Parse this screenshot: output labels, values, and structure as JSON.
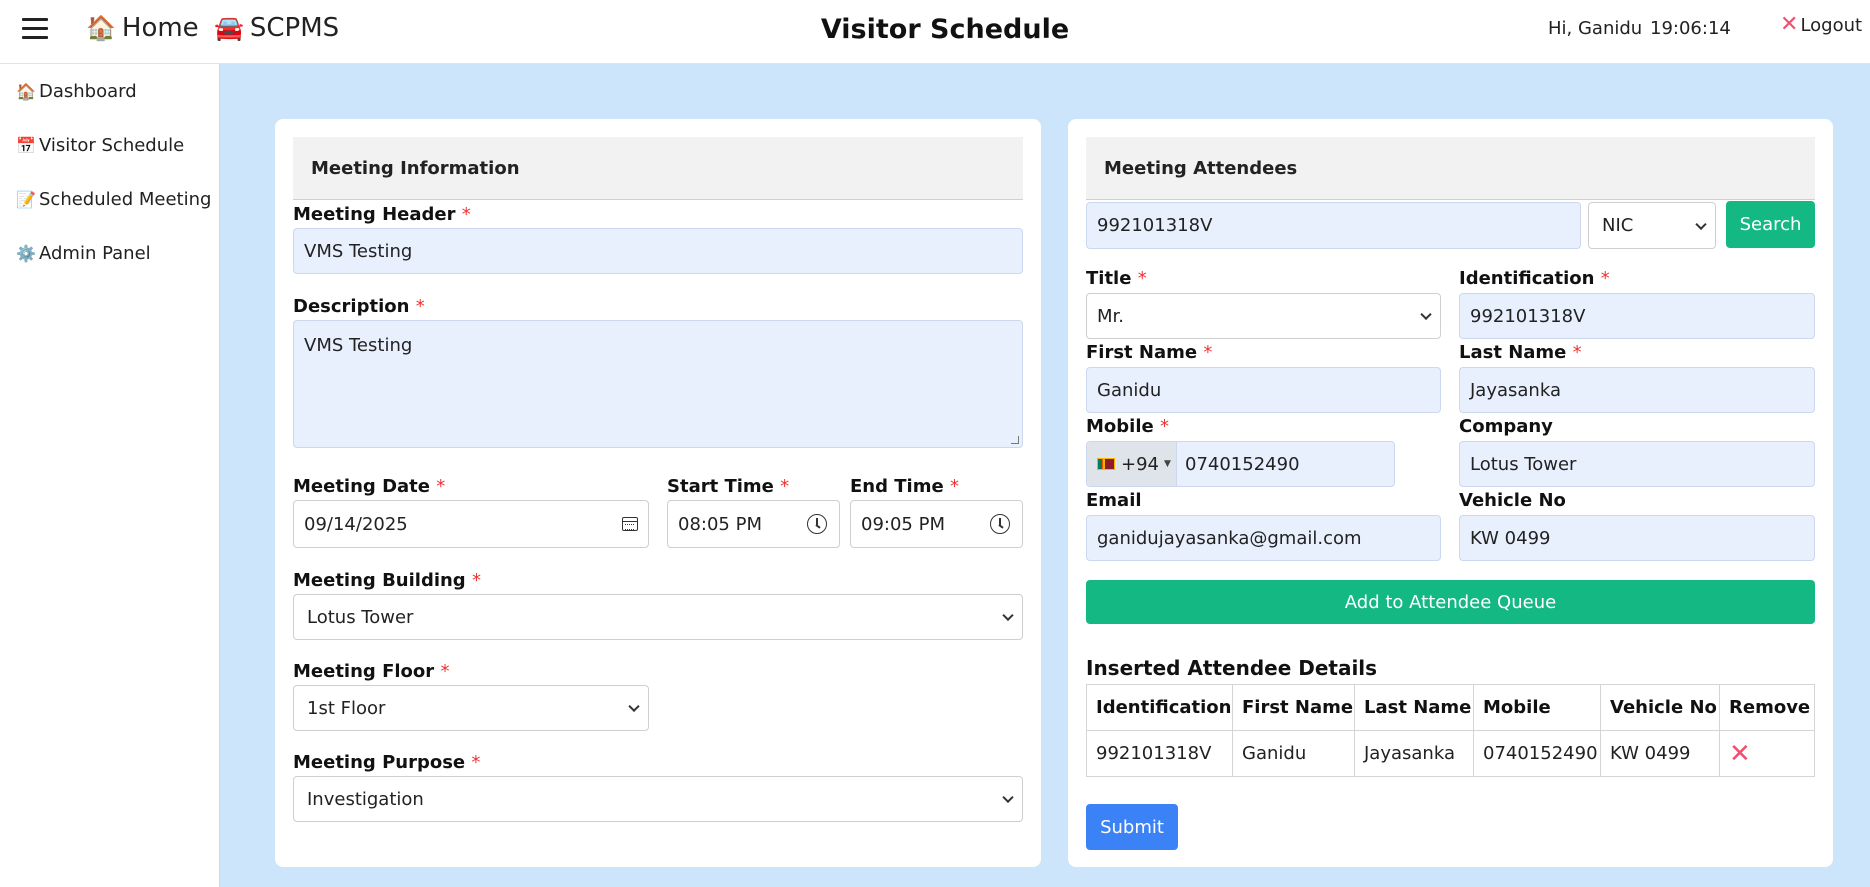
{
  "topbar": {
    "brand_home": "Home",
    "brand_scpms": "SCPMS",
    "title": "Visitor Schedule",
    "greeting": "Hi, Ganidu",
    "clock": "19:06:14",
    "logout": "Logout"
  },
  "sidebar": {
    "items": [
      {
        "label": "Dashboard",
        "icon": "house-icon"
      },
      {
        "label": "Visitor Schedule",
        "icon": "calendar-icon"
      },
      {
        "label": "Scheduled Meeting",
        "icon": "memo-icon"
      },
      {
        "label": "Admin Panel",
        "icon": "gear-icon"
      }
    ]
  },
  "meeting_info": {
    "heading": "Meeting Information",
    "header_label": "Meeting Header",
    "header_value": "VMS Testing",
    "description_label": "Description",
    "description_value": "VMS Testing",
    "date_label": "Meeting Date",
    "date_value": "09/14/2025",
    "start_label": "Start Time",
    "start_value": "08:05 PM",
    "end_label": "End Time",
    "end_value": "09:05 PM",
    "building_label": "Meeting Building",
    "building_value": "Lotus Tower",
    "floor_label": "Meeting Floor",
    "floor_value": "1st Floor",
    "purpose_label": "Meeting Purpose",
    "purpose_value": "Investigation"
  },
  "attendees": {
    "heading": "Meeting Attendees",
    "search_value": "992101318V",
    "search_type": "NIC",
    "search_button": "Search",
    "title_label": "Title",
    "title_value": "Mr.",
    "id_label": "Identification",
    "id_value": "992101318V",
    "first_label": "First Name",
    "first_value": "Ganidu",
    "last_label": "Last Name",
    "last_value": "Jayasanka",
    "mobile_label": "Mobile",
    "mobile_prefix": "+94",
    "mobile_value": "0740152490",
    "company_label": "Company",
    "company_value": "Lotus Tower",
    "email_label": "Email",
    "email_value": "ganidujayasanka@gmail.com",
    "vehicle_label": "Vehicle No",
    "vehicle_value": "KW 0499",
    "add_button": "Add to Attendee Queue",
    "inserted_title": "Inserted Attendee Details",
    "table_headers": [
      "Identification",
      "First Name",
      "Last Name",
      "Mobile",
      "Vehicle No",
      "Remove"
    ],
    "rows": [
      {
        "id": "992101318V",
        "first": "Ganidu",
        "last": "Jayasanka",
        "mobile": "0740152490",
        "vehicle": "KW 0499"
      }
    ],
    "submit_button": "Submit"
  },
  "colors": {
    "accent_green": "#14b883",
    "accent_blue": "#3b82f6",
    "page_bg": "#cce5fb",
    "required_red": "#ee3333",
    "remove_red": "#f0506e"
  }
}
